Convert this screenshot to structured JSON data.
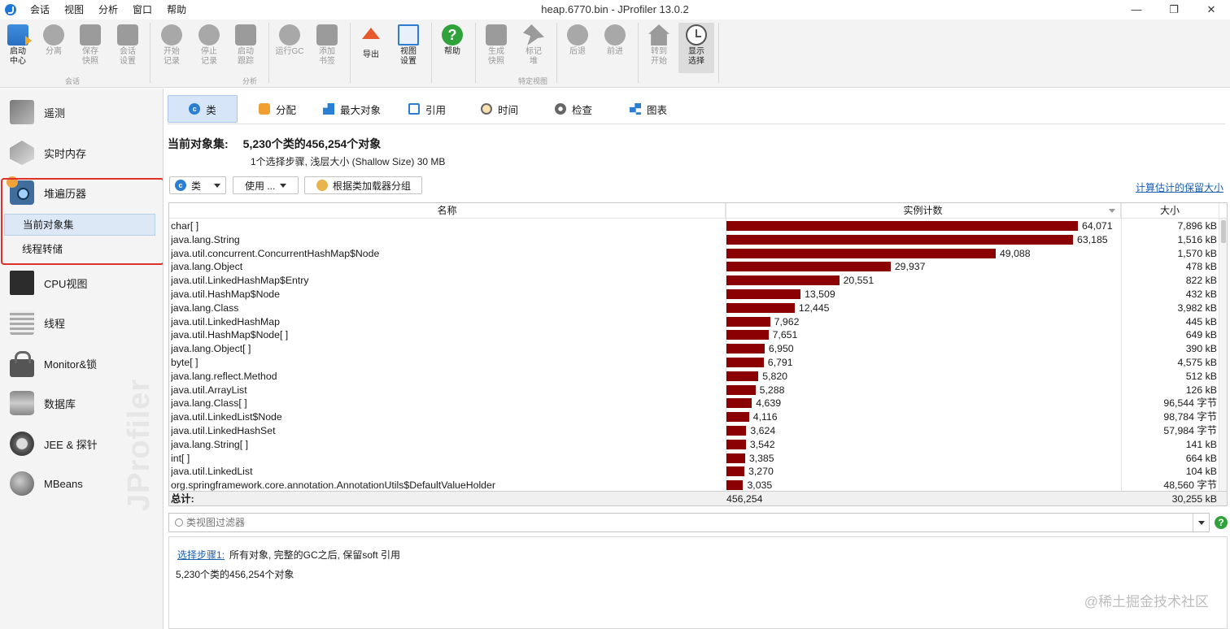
{
  "window": {
    "title": "heap.6770.bin - JProfiler 13.0.2",
    "menu": [
      "会话",
      "视图",
      "分析",
      "窗口",
      "帮助"
    ],
    "controls": [
      "—",
      "❐",
      "✕"
    ]
  },
  "toolbar": {
    "buttons": [
      {
        "label": "启动\n中心",
        "icon": "folder-icon"
      },
      {
        "label": "分离",
        "icon": "detach-icon"
      },
      {
        "label": "保存\n快照",
        "icon": "save-icon"
      },
      {
        "label": "会话\n设置",
        "icon": "session-settings-icon"
      },
      {
        "label": "开始\n记录",
        "icon": "start-recording-icon"
      },
      {
        "label": "停止\n记录",
        "icon": "stop-recording-icon"
      },
      {
        "label": "启动\n跟踪",
        "icon": "start-tracking-icon"
      },
      {
        "label": "运行GC",
        "icon": "gc-icon"
      },
      {
        "label": "添加\n书签",
        "icon": "bookmark-icon"
      },
      {
        "label": "导出",
        "icon": "export-icon"
      },
      {
        "label": "视图\n设置",
        "icon": "view-settings-icon"
      },
      {
        "label": "帮助",
        "icon": "help-icon"
      },
      {
        "label": "生成\n快照",
        "icon": "camera-icon"
      },
      {
        "label": "标记\n堆",
        "icon": "pin-icon"
      },
      {
        "label": "后退",
        "icon": "back-icon"
      },
      {
        "label": "前进",
        "icon": "forward-icon"
      },
      {
        "label": "转到\n开始",
        "icon": "home-icon"
      },
      {
        "label": "显示\n选择",
        "icon": "clock-icon"
      }
    ],
    "groups": [
      "会话",
      "分析",
      "特定视图"
    ]
  },
  "sidebar": {
    "items": [
      {
        "label": "遥测",
        "icon": "telemetry-icon"
      },
      {
        "label": "实时内存",
        "icon": "live-memory-icon"
      },
      {
        "label": "堆遍历器",
        "icon": "heap-walker-icon"
      },
      {
        "label": "CPU视图",
        "icon": "cpu-icon"
      },
      {
        "label": "线程",
        "icon": "threads-icon"
      },
      {
        "label": "Monitor&锁",
        "icon": "lock-icon"
      },
      {
        "label": "数据库",
        "icon": "database-icon"
      },
      {
        "label": "JEE & 探针",
        "icon": "jee-probe-icon"
      },
      {
        "label": "MBeans",
        "icon": "mbeans-icon"
      }
    ],
    "subitems": [
      {
        "label": "当前对象集",
        "selected": true
      },
      {
        "label": "线程转储",
        "selected": false
      }
    ],
    "watermark": "JProfiler"
  },
  "tabs": [
    {
      "label": "类",
      "icon": "class-icon",
      "active": true
    },
    {
      "label": "分配",
      "icon": "allocation-icon",
      "active": false
    },
    {
      "label": "最大对象",
      "icon": "biggest-objects-icon",
      "active": false
    },
    {
      "label": "引用",
      "icon": "references-icon",
      "active": false
    },
    {
      "label": "时间",
      "icon": "time-icon",
      "active": false
    },
    {
      "label": "检查",
      "icon": "inspections-icon",
      "active": false
    },
    {
      "label": "图表",
      "icon": "graph-icon",
      "active": false
    }
  ],
  "object_set": {
    "heading_label": "当前对象集:",
    "heading_value": "5,230个类的456,254个对象",
    "subheading": "1个选择步骤, 浅层大小 (Shallow Size) 30 MB"
  },
  "controls": {
    "class_select": "类",
    "use_button": "使用 ...",
    "group_button": "根据类加载器分组",
    "retained_link": "计算估计的保留大小"
  },
  "table": {
    "columns": [
      "名称",
      "实例计数",
      "大小"
    ],
    "max_count": 64071,
    "rows": [
      {
        "name": "char[ ]",
        "count": 64071,
        "count_label": "64,071",
        "size": "7,896 kB"
      },
      {
        "name": "java.lang.String",
        "count": 63185,
        "count_label": "63,185",
        "size": "1,516 kB"
      },
      {
        "name": "java.util.concurrent.ConcurrentHashMap$Node",
        "count": 49088,
        "count_label": "49,088",
        "size": "1,570 kB"
      },
      {
        "name": "java.lang.Object",
        "count": 29937,
        "count_label": "29,937",
        "size": "478 kB"
      },
      {
        "name": "java.util.LinkedHashMap$Entry",
        "count": 20551,
        "count_label": "20,551",
        "size": "822 kB"
      },
      {
        "name": "java.util.HashMap$Node",
        "count": 13509,
        "count_label": "13,509",
        "size": "432 kB"
      },
      {
        "name": "java.lang.Class",
        "count": 12445,
        "count_label": "12,445",
        "size": "3,982 kB"
      },
      {
        "name": "java.util.LinkedHashMap",
        "count": 7962,
        "count_label": "7,962",
        "size": "445 kB"
      },
      {
        "name": "java.util.HashMap$Node[ ]",
        "count": 7651,
        "count_label": "7,651",
        "size": "649 kB"
      },
      {
        "name": "java.lang.Object[ ]",
        "count": 6950,
        "count_label": "6,950",
        "size": "390 kB"
      },
      {
        "name": "byte[ ]",
        "count": 6791,
        "count_label": "6,791",
        "size": "4,575 kB"
      },
      {
        "name": "java.lang.reflect.Method",
        "count": 5820,
        "count_label": "5,820",
        "size": "512 kB"
      },
      {
        "name": "java.util.ArrayList",
        "count": 5288,
        "count_label": "5,288",
        "size": "126 kB"
      },
      {
        "name": "java.lang.Class[ ]",
        "count": 4639,
        "count_label": "4,639",
        "size": "96,544 字节"
      },
      {
        "name": "java.util.LinkedList$Node",
        "count": 4116,
        "count_label": "4,116",
        "size": "98,784 字节"
      },
      {
        "name": "java.util.LinkedHashSet",
        "count": 3624,
        "count_label": "3,624",
        "size": "57,984 字节"
      },
      {
        "name": "java.lang.String[ ]",
        "count": 3542,
        "count_label": "3,542",
        "size": "141 kB"
      },
      {
        "name": "int[ ]",
        "count": 3385,
        "count_label": "3,385",
        "size": "664 kB"
      },
      {
        "name": "java.util.LinkedList",
        "count": 3270,
        "count_label": "3,270",
        "size": "104 kB"
      },
      {
        "name": "org.springframework.core.annotation.AnnotationUtils$DefaultValueHolder",
        "count": 3035,
        "count_label": "3,035",
        "size": "48,560 字节"
      }
    ],
    "total": {
      "label": "总计:",
      "count": "456,254",
      "size": "30,255 kB"
    }
  },
  "filter": {
    "placeholder": "类视图过滤器"
  },
  "selection_info": {
    "step_link": "选择步骤1:",
    "step_text": "所有对象, 完整的GC之后, 保留soft 引用",
    "summary": "5,230个类的456,254个对象"
  },
  "watermark": "@稀土掘金技术社区"
}
